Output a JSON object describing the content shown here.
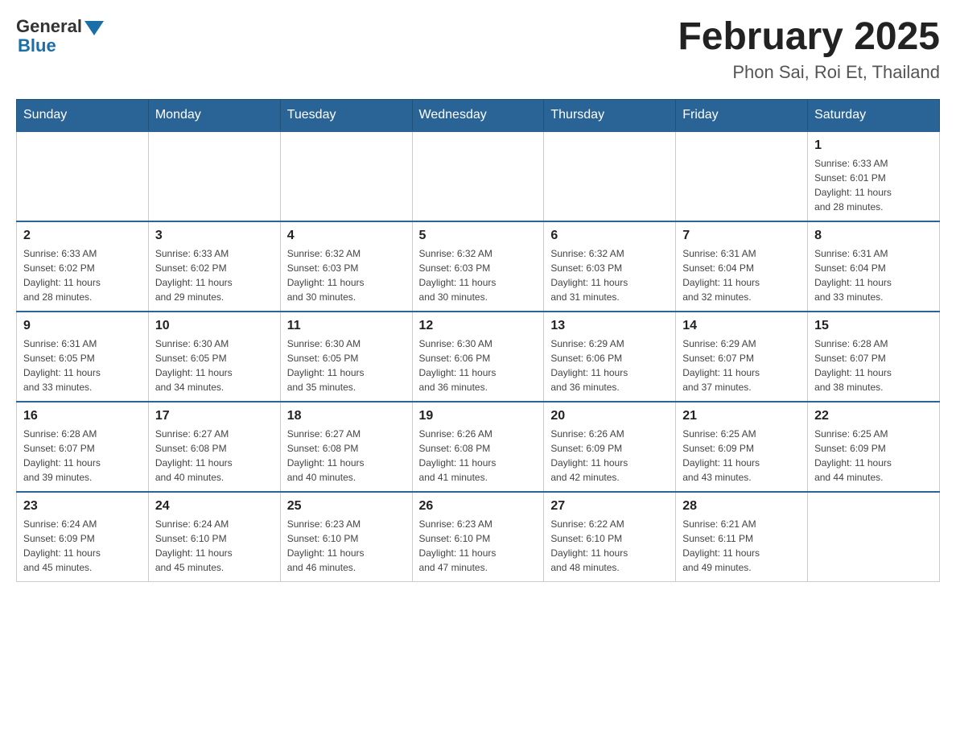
{
  "header": {
    "logo_general": "General",
    "logo_blue": "Blue",
    "month_title": "February 2025",
    "location": "Phon Sai, Roi Et, Thailand"
  },
  "days_of_week": [
    "Sunday",
    "Monday",
    "Tuesday",
    "Wednesday",
    "Thursday",
    "Friday",
    "Saturday"
  ],
  "weeks": [
    {
      "days": [
        {
          "num": "",
          "info": ""
        },
        {
          "num": "",
          "info": ""
        },
        {
          "num": "",
          "info": ""
        },
        {
          "num": "",
          "info": ""
        },
        {
          "num": "",
          "info": ""
        },
        {
          "num": "",
          "info": ""
        },
        {
          "num": "1",
          "info": "Sunrise: 6:33 AM\nSunset: 6:01 PM\nDaylight: 11 hours\nand 28 minutes."
        }
      ]
    },
    {
      "days": [
        {
          "num": "2",
          "info": "Sunrise: 6:33 AM\nSunset: 6:02 PM\nDaylight: 11 hours\nand 28 minutes."
        },
        {
          "num": "3",
          "info": "Sunrise: 6:33 AM\nSunset: 6:02 PM\nDaylight: 11 hours\nand 29 minutes."
        },
        {
          "num": "4",
          "info": "Sunrise: 6:32 AM\nSunset: 6:03 PM\nDaylight: 11 hours\nand 30 minutes."
        },
        {
          "num": "5",
          "info": "Sunrise: 6:32 AM\nSunset: 6:03 PM\nDaylight: 11 hours\nand 30 minutes."
        },
        {
          "num": "6",
          "info": "Sunrise: 6:32 AM\nSunset: 6:03 PM\nDaylight: 11 hours\nand 31 minutes."
        },
        {
          "num": "7",
          "info": "Sunrise: 6:31 AM\nSunset: 6:04 PM\nDaylight: 11 hours\nand 32 minutes."
        },
        {
          "num": "8",
          "info": "Sunrise: 6:31 AM\nSunset: 6:04 PM\nDaylight: 11 hours\nand 33 minutes."
        }
      ]
    },
    {
      "days": [
        {
          "num": "9",
          "info": "Sunrise: 6:31 AM\nSunset: 6:05 PM\nDaylight: 11 hours\nand 33 minutes."
        },
        {
          "num": "10",
          "info": "Sunrise: 6:30 AM\nSunset: 6:05 PM\nDaylight: 11 hours\nand 34 minutes."
        },
        {
          "num": "11",
          "info": "Sunrise: 6:30 AM\nSunset: 6:05 PM\nDaylight: 11 hours\nand 35 minutes."
        },
        {
          "num": "12",
          "info": "Sunrise: 6:30 AM\nSunset: 6:06 PM\nDaylight: 11 hours\nand 36 minutes."
        },
        {
          "num": "13",
          "info": "Sunrise: 6:29 AM\nSunset: 6:06 PM\nDaylight: 11 hours\nand 36 minutes."
        },
        {
          "num": "14",
          "info": "Sunrise: 6:29 AM\nSunset: 6:07 PM\nDaylight: 11 hours\nand 37 minutes."
        },
        {
          "num": "15",
          "info": "Sunrise: 6:28 AM\nSunset: 6:07 PM\nDaylight: 11 hours\nand 38 minutes."
        }
      ]
    },
    {
      "days": [
        {
          "num": "16",
          "info": "Sunrise: 6:28 AM\nSunset: 6:07 PM\nDaylight: 11 hours\nand 39 minutes."
        },
        {
          "num": "17",
          "info": "Sunrise: 6:27 AM\nSunset: 6:08 PM\nDaylight: 11 hours\nand 40 minutes."
        },
        {
          "num": "18",
          "info": "Sunrise: 6:27 AM\nSunset: 6:08 PM\nDaylight: 11 hours\nand 40 minutes."
        },
        {
          "num": "19",
          "info": "Sunrise: 6:26 AM\nSunset: 6:08 PM\nDaylight: 11 hours\nand 41 minutes."
        },
        {
          "num": "20",
          "info": "Sunrise: 6:26 AM\nSunset: 6:09 PM\nDaylight: 11 hours\nand 42 minutes."
        },
        {
          "num": "21",
          "info": "Sunrise: 6:25 AM\nSunset: 6:09 PM\nDaylight: 11 hours\nand 43 minutes."
        },
        {
          "num": "22",
          "info": "Sunrise: 6:25 AM\nSunset: 6:09 PM\nDaylight: 11 hours\nand 44 minutes."
        }
      ]
    },
    {
      "days": [
        {
          "num": "23",
          "info": "Sunrise: 6:24 AM\nSunset: 6:09 PM\nDaylight: 11 hours\nand 45 minutes."
        },
        {
          "num": "24",
          "info": "Sunrise: 6:24 AM\nSunset: 6:10 PM\nDaylight: 11 hours\nand 45 minutes."
        },
        {
          "num": "25",
          "info": "Sunrise: 6:23 AM\nSunset: 6:10 PM\nDaylight: 11 hours\nand 46 minutes."
        },
        {
          "num": "26",
          "info": "Sunrise: 6:23 AM\nSunset: 6:10 PM\nDaylight: 11 hours\nand 47 minutes."
        },
        {
          "num": "27",
          "info": "Sunrise: 6:22 AM\nSunset: 6:10 PM\nDaylight: 11 hours\nand 48 minutes."
        },
        {
          "num": "28",
          "info": "Sunrise: 6:21 AM\nSunset: 6:11 PM\nDaylight: 11 hours\nand 49 minutes."
        },
        {
          "num": "",
          "info": ""
        }
      ]
    }
  ]
}
